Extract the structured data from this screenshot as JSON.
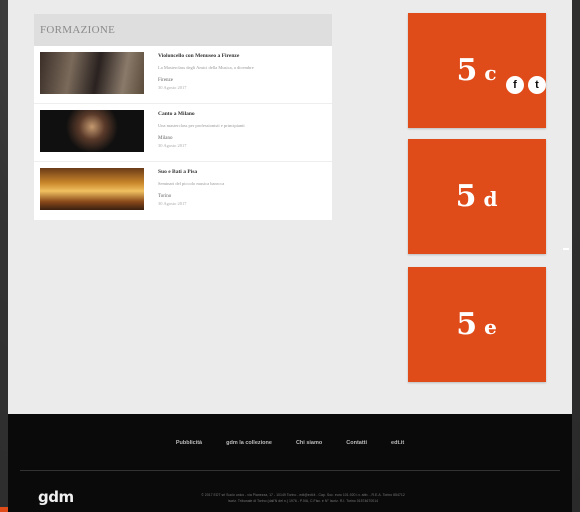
{
  "formazione": {
    "title": "FORMAZIONE",
    "articles": [
      {
        "title": "Violoncello con Menuseo a Firenze",
        "subtitle": "La Masterclass degli Amici della Musica, a dicembre",
        "city": "Firenze",
        "date": "30 Agosto 2017"
      },
      {
        "title": "Canto a Milano",
        "subtitle": "Una masterclass per professionisti e principianti",
        "city": "Milano",
        "date": "30 Agosto 2017"
      },
      {
        "title": "Suo e Bati a Pisa",
        "subtitle": "Seminari del piccolo musica barocca",
        "city": "Torino",
        "date": "30 Agosto 2017"
      }
    ]
  },
  "tiles": [
    {
      "num": "5",
      "letter": "c"
    },
    {
      "num": "5",
      "letter": "d"
    },
    {
      "num": "5",
      "letter": "e"
    }
  ],
  "footer": {
    "nav": [
      "Pubblicità",
      "gdm la collezione",
      "Chi siamo",
      "Contatti",
      "edt.it"
    ],
    "logo": "gdm",
    "legal_line1": "© 2017 EDT srl Socio unico - via Pianezza, 17 - 10149 Torino - edt@edt.it - Cap. Soc. euro 101.920 i.v. abb. - R.E.A. Torino 654712",
    "legal_line2": "Iscriz. Tribunale di Torino (dall'N del n.) 1976 - P.IVA, C.Fisc. e N° Iscriz. R.I. Torino 01574670014",
    "social": {
      "facebook": "f",
      "twitter": "t"
    }
  },
  "colors": {
    "accent": "#e04b1a",
    "footer_bg": "#0a0a0a",
    "page_bg": "#ebebeb"
  }
}
